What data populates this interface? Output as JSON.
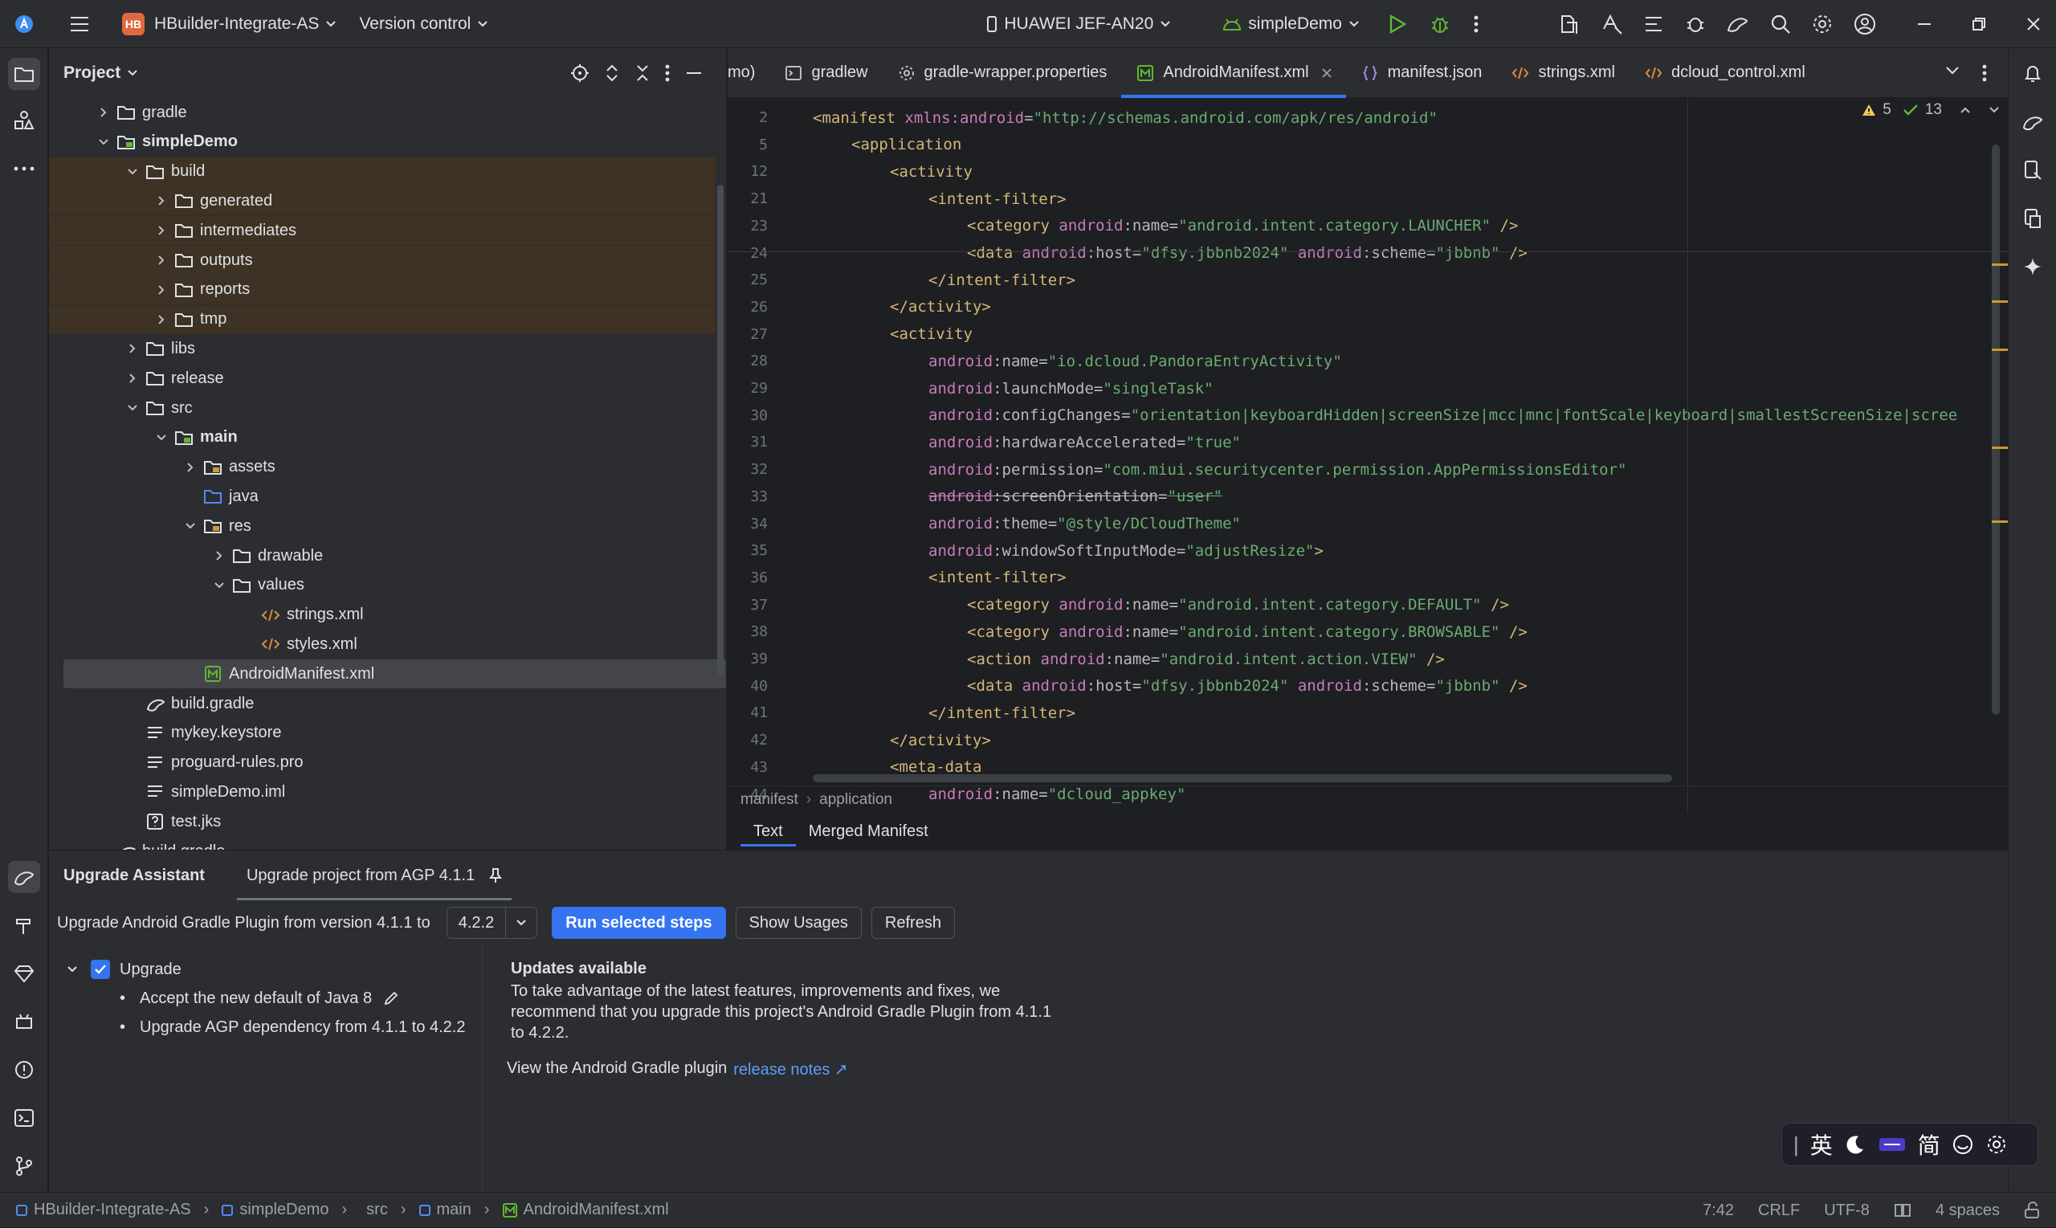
{
  "titlebar": {
    "project_badge": "HB",
    "project_name": "HBuilder-Integrate-AS",
    "vcs": "Version control",
    "device": "HUAWEI JEF-AN20",
    "run_config": "simpleDemo"
  },
  "project_panel": {
    "title": "Project",
    "tree": [
      {
        "label": "gradle",
        "type": "folder",
        "depth": 2,
        "expand": "closed"
      },
      {
        "label": "simpleDemo",
        "type": "module",
        "depth": 2,
        "expand": "open",
        "bold": true
      },
      {
        "label": "build",
        "type": "folder",
        "depth": 3,
        "expand": "open",
        "hl": true
      },
      {
        "label": "generated",
        "type": "folder",
        "depth": 4,
        "expand": "closed",
        "hl": true
      },
      {
        "label": "intermediates",
        "type": "folder",
        "depth": 4,
        "expand": "closed",
        "hl": true
      },
      {
        "label": "outputs",
        "type": "folder",
        "depth": 4,
        "expand": "closed",
        "hl": true
      },
      {
        "label": "reports",
        "type": "folder",
        "depth": 4,
        "expand": "closed",
        "hl": true
      },
      {
        "label": "tmp",
        "type": "folder",
        "depth": 4,
        "expand": "closed",
        "hl": true
      },
      {
        "label": "libs",
        "type": "folder",
        "depth": 3,
        "expand": "closed"
      },
      {
        "label": "release",
        "type": "folder",
        "depth": 3,
        "expand": "closed"
      },
      {
        "label": "src",
        "type": "folder",
        "depth": 3,
        "expand": "open"
      },
      {
        "label": "main",
        "type": "module",
        "depth": 4,
        "expand": "open",
        "bold": true
      },
      {
        "label": "assets",
        "type": "res-folder",
        "depth": 5,
        "expand": "closed"
      },
      {
        "label": "java",
        "type": "src-folder",
        "depth": 5,
        "expand": "none"
      },
      {
        "label": "res",
        "type": "res-folder",
        "depth": 5,
        "expand": "open"
      },
      {
        "label": "drawable",
        "type": "folder",
        "depth": 6,
        "expand": "closed"
      },
      {
        "label": "values",
        "type": "folder",
        "depth": 6,
        "expand": "open"
      },
      {
        "label": "strings.xml",
        "type": "xml",
        "depth": 7,
        "expand": "none"
      },
      {
        "label": "styles.xml",
        "type": "xml",
        "depth": 7,
        "expand": "none"
      },
      {
        "label": "AndroidManifest.xml",
        "type": "manifest",
        "depth": 5,
        "expand": "none",
        "sel": true
      },
      {
        "label": "build.gradle",
        "type": "gradle",
        "depth": 3,
        "expand": "none"
      },
      {
        "label": "mykey.keystore",
        "type": "text",
        "depth": 3,
        "expand": "none"
      },
      {
        "label": "proguard-rules.pro",
        "type": "text",
        "depth": 3,
        "expand": "none"
      },
      {
        "label": "simpleDemo.iml",
        "type": "text",
        "depth": 3,
        "expand": "none"
      },
      {
        "label": "test.jks",
        "type": "unknown",
        "depth": 3,
        "expand": "none"
      },
      {
        "label": "build.gradle",
        "type": "gradle",
        "depth": 2,
        "expand": "none"
      }
    ]
  },
  "editor": {
    "tabs": [
      {
        "label": "mo)",
        "icon": "none"
      },
      {
        "label": "gradlew",
        "icon": "terminal"
      },
      {
        "label": "gradle-wrapper.properties",
        "icon": "gear"
      },
      {
        "label": "AndroidManifest.xml",
        "icon": "manifest",
        "active": true
      },
      {
        "label": "manifest.json",
        "icon": "json"
      },
      {
        "label": "strings.xml",
        "icon": "xml"
      },
      {
        "label": "dcloud_control.xml",
        "icon": "xml"
      }
    ],
    "inspection": {
      "warnings": "5",
      "weak_warnings": "13"
    },
    "lines": [
      {
        "n": "2",
        "indent": 0,
        "tokens": [
          [
            "tag",
            "<manifest "
          ],
          [
            "ns",
            "xmlns:android"
          ],
          [
            "plain",
            "="
          ],
          [
            "val",
            "\"http://schemas.android.com/apk/res/android\""
          ]
        ]
      },
      {
        "n": "5",
        "indent": 1,
        "tokens": [
          [
            "tag",
            "<application"
          ]
        ]
      },
      {
        "n": "12",
        "indent": 2,
        "tokens": [
          [
            "tag",
            "<activity"
          ]
        ]
      },
      {
        "n": "21",
        "indent": 3,
        "tokens": [
          [
            "tag",
            "<intent-filter>"
          ]
        ]
      },
      {
        "n": "23",
        "indent": 4,
        "tokens": [
          [
            "tag",
            "<category "
          ],
          [
            "ns",
            "android"
          ],
          [
            "attr",
            ":name"
          ],
          [
            "plain",
            "="
          ],
          [
            "val",
            "\"android.intent.category.LAUNCHER\""
          ],
          [
            "tag",
            " />"
          ]
        ]
      },
      {
        "n": "24",
        "indent": 4,
        "tokens": [
          [
            "tag",
            "<data "
          ],
          [
            "ns",
            "android"
          ],
          [
            "attr",
            ":host"
          ],
          [
            "plain",
            "="
          ],
          [
            "val",
            "\"dfsy.jbbnb2024\""
          ],
          [
            "plain",
            " "
          ],
          [
            "ns",
            "android"
          ],
          [
            "attr",
            ":scheme"
          ],
          [
            "plain",
            "="
          ],
          [
            "val",
            "\"jbbnb\""
          ],
          [
            "tag",
            " />"
          ]
        ]
      },
      {
        "n": "25",
        "indent": 3,
        "tokens": [
          [
            "tag",
            "</intent-filter>"
          ]
        ]
      },
      {
        "n": "26",
        "indent": 2,
        "tokens": [
          [
            "tag",
            "</activity>"
          ]
        ]
      },
      {
        "n": "27",
        "indent": 2,
        "tokens": [
          [
            "tag",
            "<activity"
          ]
        ]
      },
      {
        "n": "28",
        "indent": 3,
        "tokens": [
          [
            "ns",
            "android"
          ],
          [
            "attr",
            ":name"
          ],
          [
            "plain",
            "="
          ],
          [
            "val",
            "\"io.dcloud.PandoraEntryActivity\""
          ]
        ]
      },
      {
        "n": "29",
        "indent": 3,
        "tokens": [
          [
            "ns",
            "android"
          ],
          [
            "attr",
            ":launchMode"
          ],
          [
            "plain",
            "="
          ],
          [
            "val",
            "\"singleTask\""
          ]
        ]
      },
      {
        "n": "30",
        "indent": 3,
        "tokens": [
          [
            "ns",
            "android"
          ],
          [
            "attr",
            ":configChanges"
          ],
          [
            "plain",
            "="
          ],
          [
            "val",
            "\"orientation|keyboardHidden|screenSize|mcc|mnc|fontScale|keyboard|smallestScreenSize|scree"
          ]
        ]
      },
      {
        "n": "31",
        "indent": 3,
        "tokens": [
          [
            "ns",
            "android"
          ],
          [
            "attr",
            ":hardwareAccelerated"
          ],
          [
            "plain",
            "="
          ],
          [
            "val",
            "\"true\""
          ]
        ]
      },
      {
        "n": "32",
        "indent": 3,
        "tokens": [
          [
            "ns",
            "android"
          ],
          [
            "attr",
            ":permission"
          ],
          [
            "plain",
            "="
          ],
          [
            "val",
            "\"com.miui.securitycenter.permission.AppPermissionsEditor\""
          ]
        ]
      },
      {
        "n": "33",
        "indent": 3,
        "strike": true,
        "tokens": [
          [
            "ns",
            "android"
          ],
          [
            "attr",
            ":screenOrientation"
          ],
          [
            "plain",
            "="
          ],
          [
            "val",
            "\"user\""
          ]
        ]
      },
      {
        "n": "34",
        "indent": 3,
        "tokens": [
          [
            "ns",
            "android"
          ],
          [
            "attr",
            ":theme"
          ],
          [
            "plain",
            "="
          ],
          [
            "val",
            "\"@style/DCloudTheme\""
          ]
        ]
      },
      {
        "n": "35",
        "indent": 3,
        "tokens": [
          [
            "ns",
            "android"
          ],
          [
            "attr",
            ":windowSoftInputMode"
          ],
          [
            "plain",
            "="
          ],
          [
            "val",
            "\"adjustResize\""
          ],
          [
            "tag",
            ">"
          ]
        ]
      },
      {
        "n": "36",
        "indent": 3,
        "tokens": [
          [
            "tag",
            "<intent-filter>"
          ]
        ]
      },
      {
        "n": "37",
        "indent": 4,
        "tokens": [
          [
            "tag",
            "<category "
          ],
          [
            "ns",
            "android"
          ],
          [
            "attr",
            ":name"
          ],
          [
            "plain",
            "="
          ],
          [
            "val",
            "\"android.intent.category.DEFAULT\""
          ],
          [
            "tag",
            " />"
          ]
        ]
      },
      {
        "n": "38",
        "indent": 4,
        "tokens": [
          [
            "tag",
            "<category "
          ],
          [
            "ns",
            "android"
          ],
          [
            "attr",
            ":name"
          ],
          [
            "plain",
            "="
          ],
          [
            "val",
            "\"android.intent.category.BROWSABLE\""
          ],
          [
            "tag",
            " />"
          ]
        ]
      },
      {
        "n": "39",
        "indent": 4,
        "tokens": [
          [
            "tag",
            "<action "
          ],
          [
            "ns",
            "android"
          ],
          [
            "attr",
            ":name"
          ],
          [
            "plain",
            "="
          ],
          [
            "val",
            "\"android.intent.action.VIEW\""
          ],
          [
            "tag",
            " />"
          ]
        ]
      },
      {
        "n": "40",
        "indent": 4,
        "tokens": [
          [
            "tag",
            "<data "
          ],
          [
            "ns",
            "android"
          ],
          [
            "attr",
            ":host"
          ],
          [
            "plain",
            "="
          ],
          [
            "val",
            "\"dfsy.jbbnb2024\""
          ],
          [
            "plain",
            " "
          ],
          [
            "ns",
            "android"
          ],
          [
            "attr",
            ":scheme"
          ],
          [
            "plain",
            "="
          ],
          [
            "val",
            "\"jbbnb\""
          ],
          [
            "tag",
            " />"
          ]
        ]
      },
      {
        "n": "41",
        "indent": 3,
        "tokens": [
          [
            "tag",
            "</intent-filter>"
          ]
        ]
      },
      {
        "n": "42",
        "indent": 2,
        "tokens": [
          [
            "tag",
            "</activity>"
          ]
        ]
      },
      {
        "n": "43",
        "indent": 2,
        "tokens": [
          [
            "tag",
            "<meta-data"
          ]
        ]
      },
      {
        "n": "44",
        "indent": 3,
        "tokens": [
          [
            "ns",
            "android"
          ],
          [
            "attr",
            ":name"
          ],
          [
            "plain",
            "="
          ],
          [
            "val",
            "\"dcloud_appkey\""
          ]
        ]
      }
    ],
    "breadcrumb": [
      "manifest",
      "application"
    ],
    "bottom_tabs": [
      "Text",
      "Merged Manifest"
    ]
  },
  "upgrade": {
    "title": "Upgrade Assistant",
    "subtitle": "Upgrade project from AGP 4.1.1",
    "toolbar_label": "Upgrade Android Gradle Plugin from version 4.1.1 to",
    "version": "4.2.2",
    "run_btn": "Run selected steps",
    "usages_btn": "Show Usages",
    "refresh_btn": "Refresh",
    "root": "Upgrade",
    "steps": [
      "Accept the new default of Java 8",
      "Upgrade AGP dependency from 4.1.1 to 4.2.2"
    ],
    "details_title": "Updates available",
    "details_text_1": "To take advantage of the latest features, improvements and fixes, we",
    "details_text_2": "recommend that you upgrade this project's Android Gradle Plugin from 4.1.1",
    "details_text_3": "to 4.2.2.",
    "release_prefix": "View the Android Gradle plugin",
    "release_link": "release notes ↗"
  },
  "statusbar": {
    "crumbs": [
      "HBuilder-Integrate-AS",
      "simpleDemo",
      "src",
      "main",
      "AndroidManifest.xml"
    ],
    "position": "7:42",
    "line_sep": "CRLF",
    "encoding": "UTF-8",
    "indent": "4 spaces"
  },
  "ime": {
    "lang": "英",
    "mode": "简"
  },
  "colors": {
    "accent": "#3574f0",
    "bg": "#1e1f22",
    "panel": "#2b2d30",
    "tag": "#d5b778",
    "val": "#6aab73",
    "ns": "#c77dbb"
  }
}
